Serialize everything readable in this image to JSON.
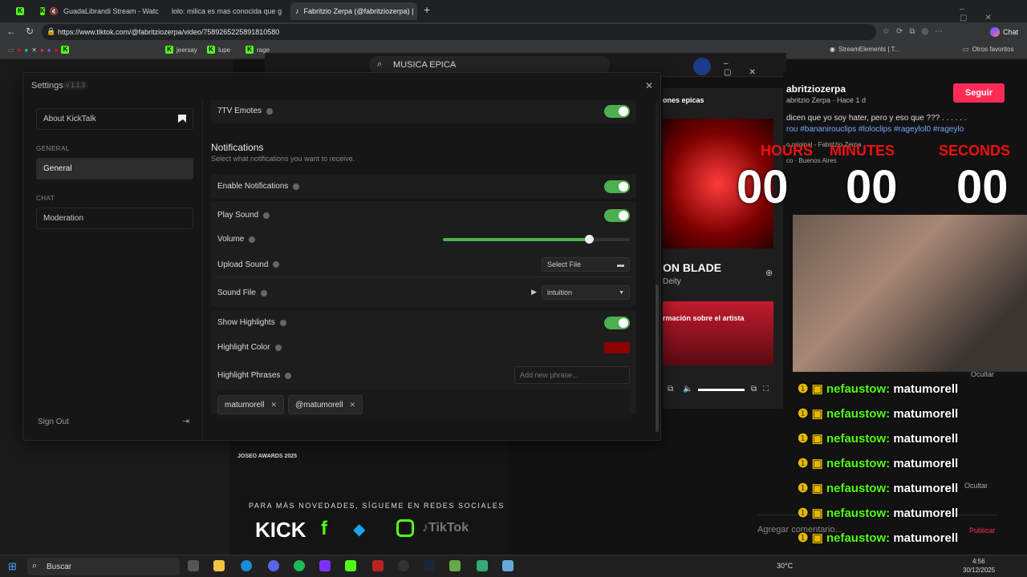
{
  "browser": {
    "tabs": [
      {
        "label": "GuadaLibrandi Stream - Watc"
      },
      {
        "label": "lolo: milica es mas conocida que g"
      },
      {
        "label": "Fabritzio Zerpa (@fabritziozerpa) |"
      }
    ],
    "new_tab": "+",
    "url": "https://www.tiktok.com/@fabritziozerpa/video/7589265225891810580",
    "copilot_label": "Chat",
    "bookmarks": [
      "jeersay",
      "lupe",
      "rage",
      "StreamElements | T...",
      "Otros favoritos"
    ]
  },
  "background": {
    "search_text": "MUSICA EPICA",
    "spotify_heading": "ones epicas",
    "spotify_song": "ON BLADE",
    "spotify_artist": "Deity",
    "spotify_more": "rmación sobre el artista",
    "tiktok_user": "abritziozerpa",
    "tiktok_sub": "abritzio Zerpa · Hace 1 d",
    "follow_label": "Seguir",
    "caption": "dicen que yo soy hater, pero y eso que ??? . . . . . .",
    "hashtags": "rou #bananirouclips #loloclips #rageylol0 #rageylo",
    "sound": "o original - Fabritzio Zerpa",
    "location": "co · Buenos Aires",
    "timer_labels": [
      "HOURS",
      "MINUTES",
      "SECONDS"
    ],
    "timer_values": [
      "00",
      "00",
      "00"
    ],
    "promo": "PARA MÁS NOVEDADES, SÍGUEME EN REDES SOCIALES",
    "video_title": "JOSEO AWARDS 2025",
    "comment_placeholder": "Agregar comentario...",
    "publish_label": "Publicar",
    "hide_label": "Ocultar",
    "chat_lines": [
      {
        "user": "nefaustow:",
        "msg": "matumorell"
      },
      {
        "user": "nefaustow:",
        "msg": "matumorell"
      },
      {
        "user": "nefaustow:",
        "msg": "matumorell"
      },
      {
        "user": "nefaustow:",
        "msg": "matumorell"
      },
      {
        "user": "nefaustow:",
        "msg": "matumorell"
      },
      {
        "user": "nefaustow:",
        "msg": "matumorell"
      },
      {
        "user": "nefaustow:",
        "msg": "matumorell"
      },
      {
        "user": "nefaustow:",
        "msg": "matumorell"
      }
    ]
  },
  "settings": {
    "title": "Settings",
    "version": "v 1.1.3",
    "nav": {
      "about": "About KickTalk",
      "general_header": "GENERAL",
      "general": "General",
      "chat_header": "CHAT",
      "moderation": "Moderation",
      "sign_out": "Sign Out"
    },
    "seventv_label": "7TV Emotes",
    "notifications": {
      "heading": "Notifications",
      "description": "Select what notifications you want to receive.",
      "enable": "Enable Notifications",
      "play_sound": "Play Sound",
      "volume": "Volume",
      "volume_value": 0.78,
      "upload_sound": "Upload Sound",
      "select_file": "Select File",
      "sound_file": "Sound File",
      "sound_file_value": "intuition",
      "show_highlights": "Show Highlights",
      "highlight_color": "Highlight Color",
      "highlight_color_value": "#8b0000",
      "highlight_phrases": "Highlight Phrases",
      "phrase_placeholder": "Add new phrase...",
      "phrases": [
        "matumorell",
        "@matumorell"
      ]
    }
  },
  "taskbar": {
    "search": "Buscar",
    "weather": "30°C",
    "time": "4:56",
    "date": "30/12/2025"
  },
  "colors": {
    "accent_green": "#4caf50",
    "kick_green": "#53fc18",
    "follow_red": "#fe2c55"
  }
}
